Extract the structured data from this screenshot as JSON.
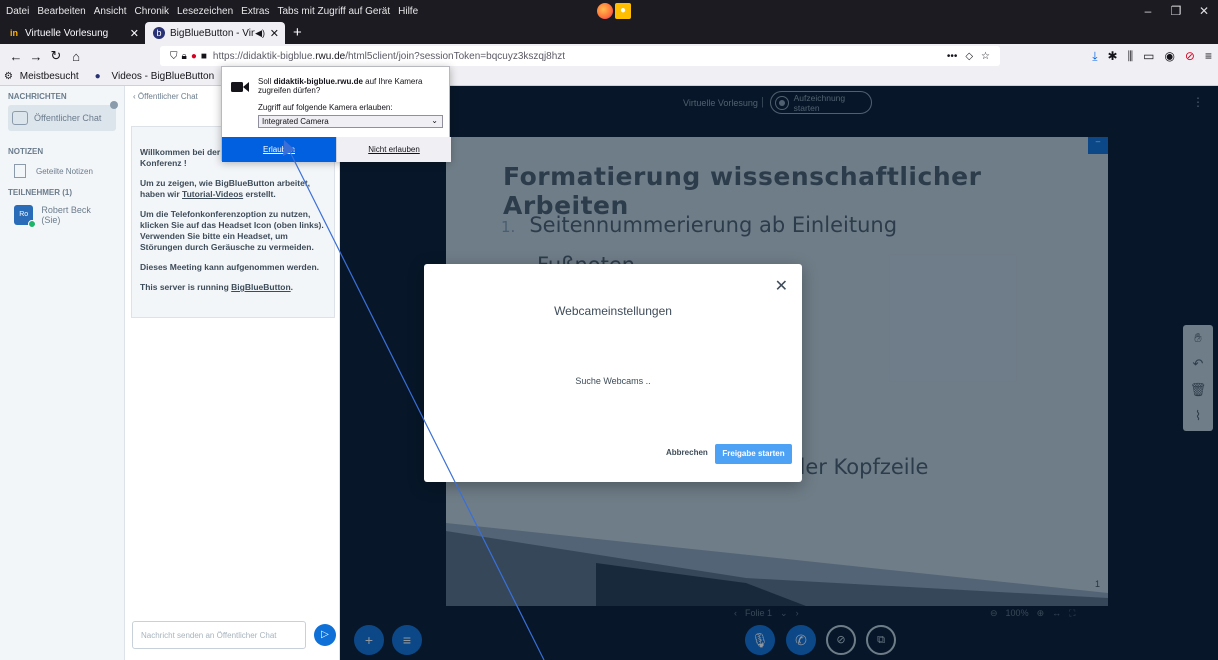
{
  "menubar": {
    "items": [
      "Datei",
      "Bearbeiten",
      "Ansicht",
      "Chronik",
      "Lesezeichen",
      "Extras",
      "Tabs mit Zugriff auf Gerät",
      "Hilfe"
    ]
  },
  "window_controls": {
    "minimize": "–",
    "maximize": "❐",
    "close": "✕"
  },
  "tabs": [
    {
      "label": "Virtuelle Vorlesung",
      "favicon": "ilias-icon"
    },
    {
      "label": "BigBlueButton - Virtuelle Vo",
      "favicon": "bbb-icon"
    }
  ],
  "urlbar": {
    "url_prefix": "https://didaktik-bigblue.",
    "url_domain": "rwu.de",
    "url_suffix": "/html5client/join?sessionToken=bqcuyz3kszqj8hzt"
  },
  "bookmarks": [
    "Meistbesucht",
    "Videos - BigBlueButton"
  ],
  "permission_popup": {
    "question_prefix": "Soll ",
    "question_domain": "didaktik-bigblue.rwu.de",
    "question_suffix": " auf Ihre Kamera zugreifen dürfen?",
    "label": "Zugriff auf folgende Kamera erlauben:",
    "selected_camera": "Integrated Camera",
    "allow_label": "Erlauben",
    "deny_label": "Nicht erlauben"
  },
  "left_panel": {
    "messages_header": "NACHRICHTEN",
    "public_chat": "Öffentlicher Chat",
    "notes_header": "NOTIZEN",
    "shared_notes": "Geteilte Notizen",
    "participants_header": "TEILNEHMER (1)",
    "user_initials": "Ro",
    "user_name": "Robert Beck (Sie)"
  },
  "chat": {
    "header": "Öffentlicher Chat",
    "welcome_1": "Willkommen bei der V",
    "welcome_1b": "Konferenz !",
    "welcome_2a": "Um zu zeigen, wie BigBlueButton arbeitet, haben wir ",
    "welcome_2_link": "Tutorial-Videos",
    "welcome_2b": " erstellt.",
    "welcome_3a": "Um die Telefonkonferenzoption zu nutzen, klicken Sie auf das Headset Icon (oben links). ",
    "welcome_3b": "Verwenden Sie bitte ein Headset, um Störungen durch Geräusche zu vermeiden.",
    "welcome_4": "Dieses Meeting kann aufgenommen werden.",
    "welcome_5a": "This server is running ",
    "welcome_5_link": "BigBlueButton",
    "welcome_5b": ".",
    "input_placeholder": "Nachricht senden an Öffentlicher Chat"
  },
  "main": {
    "meeting_title": "Virtuelle Vorlesung",
    "record_label": "Aufzeichnung starten",
    "slide": {
      "title": "Formatierung wissenschaftlicher Arbeiten",
      "item1_num": "1.",
      "item1": "Seitennummerierung ab Einleitung",
      "item2": "Fußnoten",
      "item_tail": "der Kopfzeile",
      "page_number": "1"
    },
    "slide_controls": {
      "page_label": "Folie 1",
      "zoom": "100%"
    }
  },
  "modal": {
    "title": "Webcameinstellungen",
    "status": "Suche Webcams ..",
    "cancel": "Abbrechen",
    "start": "Freigabe starten"
  },
  "colors": {
    "bbb_blue": "#0f70d7",
    "firefox_blue": "#0060df",
    "dark_bg": "#06172a"
  }
}
